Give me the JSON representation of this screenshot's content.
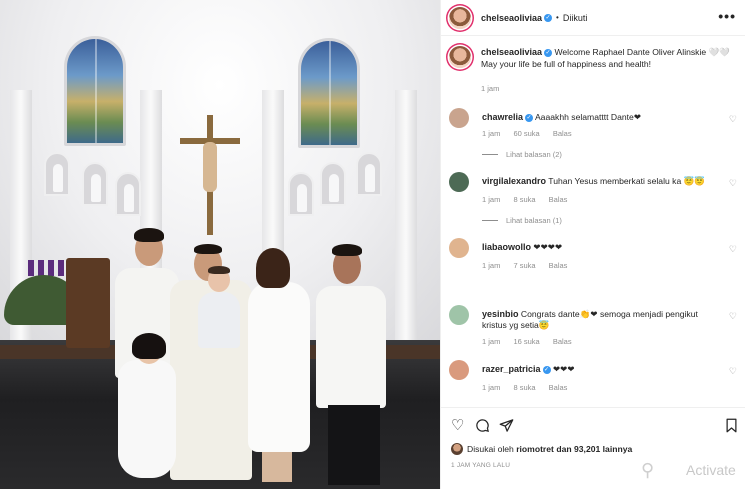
{
  "post": {
    "username": "chelseaoliviaa",
    "follow_status": "Diikuti",
    "more": "•••"
  },
  "caption": {
    "text": "Welcome Raphael Dante Oliver Alinskie 🤍🤍 May your life be full of happiness and health!",
    "time": "1 jam"
  },
  "comments": [
    {
      "user": "chawrelia",
      "verified": true,
      "text": "Aaaakhh selamatttt Dante❤",
      "time": "1 jam",
      "likes": "60 suka",
      "reply": "Balas",
      "replies": "Lihat balasan (2)",
      "avatar_color": "#c9a48e"
    },
    {
      "user": "virgilalexandro",
      "verified": false,
      "text": "Tuhan Yesus memberkati selalu ka 😇😇",
      "time": "1 jam",
      "likes": "8 suka",
      "reply": "Balas",
      "replies": "Lihat balasan (1)",
      "avatar_color": "#4d6a55"
    },
    {
      "user": "liabaowollo",
      "verified": false,
      "text": "❤❤❤❤",
      "time": "1 jam",
      "likes": "7 suka",
      "reply": "Balas",
      "replies": "",
      "avatar_color": "#e0b48f"
    },
    {
      "user": "yesinbio",
      "verified": false,
      "text": "Congrats dante👏❤ semoga menjadi pengikut kristus yg setia😇",
      "time": "1 jam",
      "likes": "16 suka",
      "reply": "Balas",
      "replies": "",
      "avatar_color": "#9fc4a8"
    },
    {
      "user": "razer_patricia",
      "verified": true,
      "text": "❤❤❤",
      "time": "1 jam",
      "likes": "8 suka",
      "reply": "Balas",
      "replies": "",
      "avatar_color": "#d99a7e"
    }
  ],
  "likes_text": {
    "prefix": "Disukai oleh",
    "user": "riomotret",
    "suffix": "dan 93,201 lainnya"
  },
  "post_time": "1 JAM YANG LALU",
  "watermark": "Activate",
  "icons": {
    "like": "heart-outline-icon",
    "comment": "comment-bubble-icon",
    "share": "paper-plane-icon",
    "save": "bookmark-icon",
    "verified": "verified-badge-icon"
  },
  "colors": {
    "verified": "#3897f0",
    "muted": "#8e8e8e",
    "text": "#262626",
    "story_ring": "#e1306c"
  }
}
